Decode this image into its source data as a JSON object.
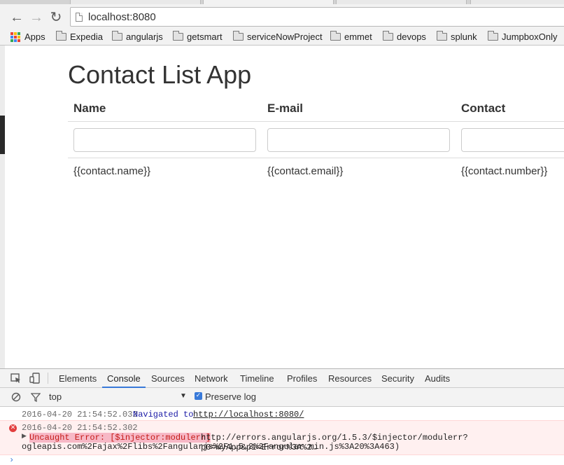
{
  "browser": {
    "url": "localhost:8080",
    "back_glyph": "←",
    "forward_glyph": "→",
    "reload_glyph": "↻",
    "bookmarks": [
      {
        "label": "Apps",
        "icon": "apps-icon"
      },
      {
        "label": "Expedia",
        "icon": "folder-icon"
      },
      {
        "label": "angularjs",
        "icon": "folder-icon"
      },
      {
        "label": "getsmart",
        "icon": "folder-icon"
      },
      {
        "label": "serviceNowProject",
        "icon": "folder-icon"
      },
      {
        "label": "emmet",
        "icon": "folder-icon"
      },
      {
        "label": "devops",
        "icon": "folder-icon"
      },
      {
        "label": "splunk",
        "icon": "folder-icon"
      },
      {
        "label": "JumpboxOnly",
        "icon": "folder-icon"
      }
    ]
  },
  "page": {
    "title": "Contact List App",
    "columns": [
      "Name",
      "E-mail",
      "Contact"
    ],
    "row": [
      "{{contact.name}}",
      "{{contact.email}}",
      "{{contact.number}}"
    ]
  },
  "devtools": {
    "tabs": [
      "Elements",
      "Console",
      "Sources",
      "Network",
      "Timeline",
      "Profiles",
      "Resources",
      "Security",
      "Audits"
    ],
    "active_tab": "Console",
    "context": "top",
    "preserve_log_label": "Preserve log",
    "preserve_log_checked": true,
    "logs": {
      "nav_time": "2016-04-20 21:54:52.032",
      "nav_text": "Navigated to",
      "nav_url": "http://localhost:8080/",
      "err_time": "2016-04-20 21:54:52.302",
      "err_label": "Uncaught Error: [$injector:modulerr]",
      "err_url_1": "http://errors.angularjs.org/1.5.3/$injector/modulerr?p0=myApp&p1=Error%3A%2…",
      "err_url_2": "ogleapis.com%2Fajax%2Flibs%2Fangularjs%2F1.5.3%2Fangular.min.js%3A20%3A463)"
    },
    "prompt_glyph": "›"
  },
  "colors": {
    "accent": "#3879d9",
    "error": "#e23d3d",
    "error_bg": "#fff0f0"
  }
}
